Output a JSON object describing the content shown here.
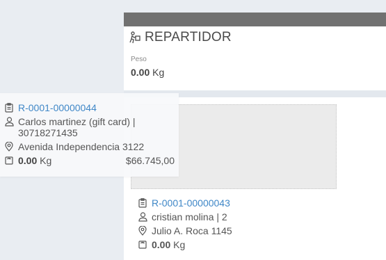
{
  "panel": {
    "title": "REPARTIDOR",
    "title_icon": "delivery-person-icon",
    "peso_label": "Peso",
    "peso_value": "0.00",
    "peso_unit": "Kg"
  },
  "floating_card": {
    "code": "R-0001-00000044",
    "customer": "Carlos martinez (gift card) | 30718271435",
    "address": "Avenida Independencia 3122",
    "weight": "0.00",
    "weight_unit": "Kg",
    "price": "$66.745,00"
  },
  "order_card": {
    "code": "R-0001-00000043",
    "customer": "cristian molina | 2",
    "address": "Julio A. Roca 1145",
    "weight": "0.00",
    "weight_unit": "Kg"
  },
  "icons": {
    "code": "clipboard-icon",
    "customer": "user-icon",
    "address": "map-pin-icon",
    "weight": "weight-scale-icon"
  },
  "colors": {
    "link": "#3f87c7",
    "header_bar": "#717171",
    "background": "#e9edf2"
  }
}
